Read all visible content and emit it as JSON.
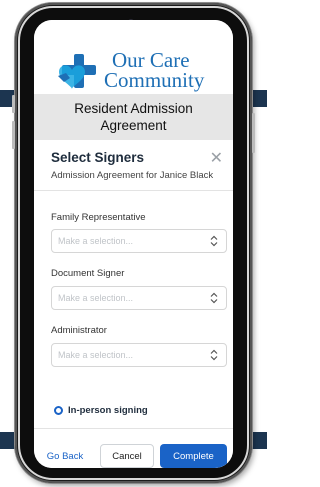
{
  "brand": {
    "logo_line1": "Our Care",
    "logo_line2": "Community"
  },
  "page_title": {
    "line1": "Resident Admission",
    "line2": "Agreement"
  },
  "modal": {
    "title": "Select Signers",
    "close_icon": "close-icon",
    "subtitle": "Admission Agreement for Janice Black",
    "fields": [
      {
        "label": "Family Representative",
        "placeholder": "Make a selection..."
      },
      {
        "label": "Document Signer",
        "placeholder": "Make a selection..."
      },
      {
        "label": "Administrator",
        "placeholder": "Make a selection..."
      }
    ],
    "in_person_label": "In-person signing",
    "buttons": {
      "back": "Go Back",
      "cancel": "Cancel",
      "complete": "Complete"
    }
  },
  "colors": {
    "accent": "#1a63c7",
    "brand_blue": "#1e6fb5",
    "band": "#1c3550",
    "title_bar_bg": "#e6e6e6"
  }
}
